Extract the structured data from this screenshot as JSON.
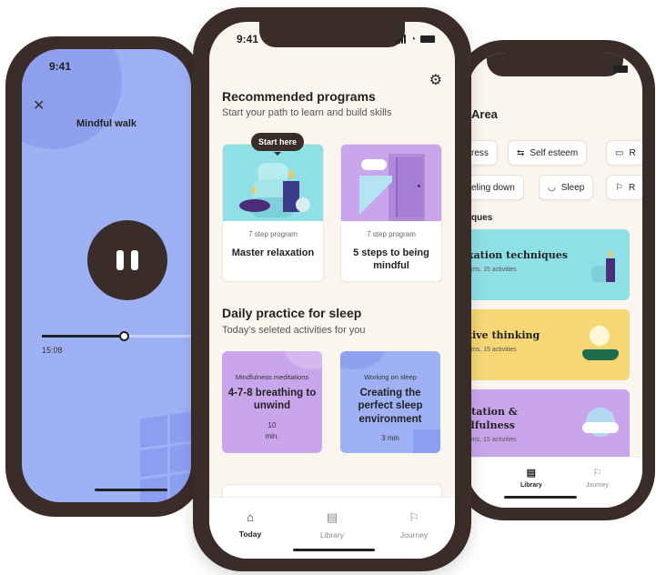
{
  "left_phone": {
    "status_time": "9:41",
    "player_title": "Mindful walk",
    "elapsed_time": "15:08",
    "progress": 0.55
  },
  "center_phone": {
    "status_time": "9:41",
    "recommended": {
      "title": "Recommended programs",
      "subtitle": "Start your path to learn and build skills",
      "tooltip": "Start here",
      "cards": [
        {
          "meta": "7 step program",
          "name": "Master relaxation"
        },
        {
          "meta": "7 step program",
          "name": "5 steps to being mindful"
        }
      ]
    },
    "daily": {
      "title": "Daily practice for sleep",
      "subtitle": "Today’s seleted activities for you",
      "cards": [
        {
          "category": "Mindfulness meditations",
          "name": "4-7-8 breathing to unwind",
          "duration_value": "10",
          "duration_unit": "min."
        },
        {
          "category": "Working on sleep",
          "name": "Creating the perfect sleep environment",
          "duration": "3 min"
        }
      ]
    },
    "tabs": [
      {
        "label": "Today",
        "icon": "home-icon",
        "active": true
      },
      {
        "label": "Library",
        "icon": "book-icon",
        "active": false
      },
      {
        "label": "Journey",
        "icon": "flag-icon",
        "active": false
      }
    ]
  },
  "right_phone": {
    "focus_heading": "Area",
    "chips_row1": [
      "ress",
      "Self esteem",
      "R"
    ],
    "chips_row2": [
      "eling down",
      "Sleep",
      "R"
    ],
    "techniques_heading": "ques",
    "library_cards": [
      {
        "title": "xation techniques",
        "sub": "ams, 15 activities",
        "color": "#8fe0e6"
      },
      {
        "title": "tive thinking",
        "sub": "ams, 15 activities",
        "color": "#f6d675"
      },
      {
        "title_line1": "itation &",
        "title_line2": "dfulness",
        "sub": "ams, 15 activities",
        "color": "#c9a6ec"
      }
    ],
    "tabs": [
      {
        "label": "Library",
        "icon": "book-icon"
      },
      {
        "label": "Journey",
        "icon": "flag-icon"
      }
    ]
  },
  "colors": {
    "phone_frame": "#3a2c28",
    "background_cream": "#fbf5ef",
    "player_blue": "#9fb1f5",
    "teal": "#8fe0e6",
    "lavender": "#c9a6ec",
    "yellow": "#f6d675"
  }
}
